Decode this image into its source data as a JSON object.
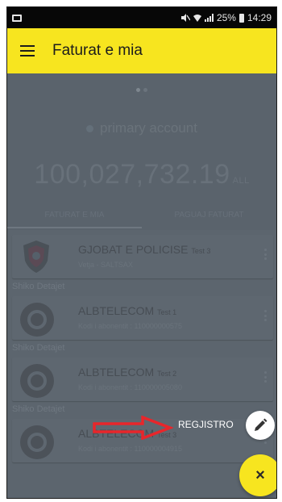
{
  "status_bar": {
    "battery": "25%",
    "time": "14:29"
  },
  "app_bar": {
    "title": "Faturat e mia"
  },
  "account": {
    "name": "primary account",
    "balance": "100,027,732.19",
    "currency": "ALL"
  },
  "tabs": [
    {
      "label": "FATURAT E MIA",
      "active": true
    },
    {
      "label": "PAGUAJ FATURAT",
      "active": false
    }
  ],
  "bills": [
    {
      "name": "GJOBAT E POLICISE",
      "tag": "Test 3",
      "sub": "Vetja - SALTSAX",
      "details": "Shiko Detajet"
    },
    {
      "name": "ALBTELECOM",
      "tag": "Test 1",
      "sub": "Kodi i abonentit : 110000000575",
      "details": "Shiko Detajet"
    },
    {
      "name": "ALBTELECOM",
      "tag": "Test 2",
      "sub": "Kodi i abonentit : 110000005080",
      "details": "Shiko Detajet"
    },
    {
      "name": "ALBTELECOM",
      "tag": "Test 3",
      "sub": "Kodi i abonentit : 110000004915",
      "details": ""
    }
  ],
  "fab": {
    "register_label": "REGJISTRO",
    "close_symbol": "×"
  },
  "colors": {
    "accent": "#f7e51f",
    "overlay": "#5a636c",
    "arrow": "#e8262b"
  }
}
